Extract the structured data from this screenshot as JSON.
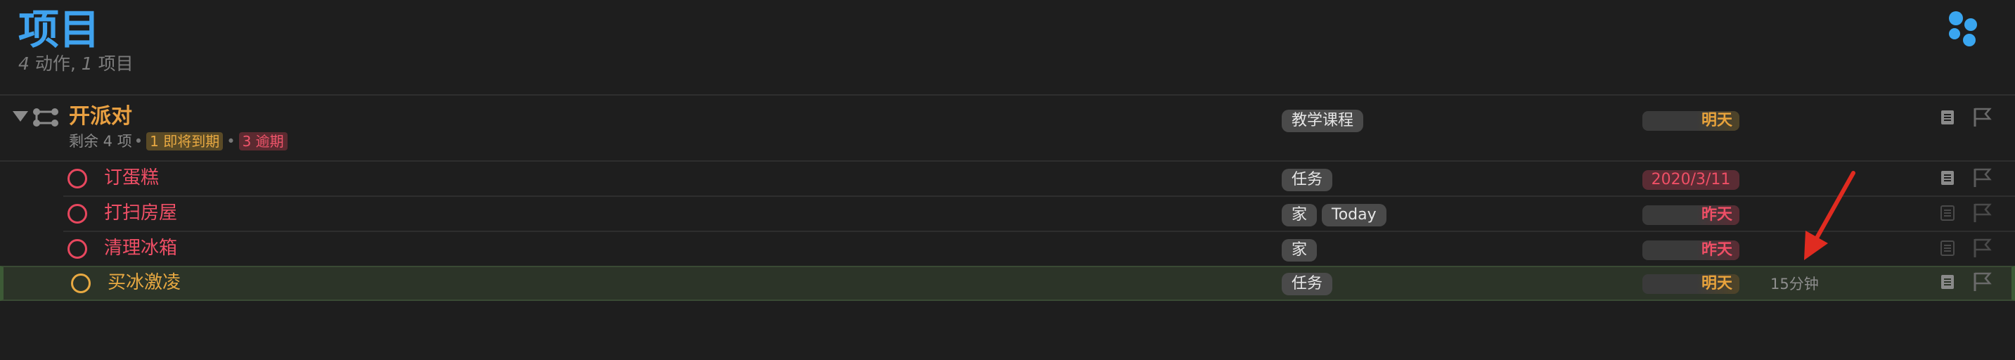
{
  "header": {
    "title": "项目",
    "subtitle_count1": "4",
    "subtitle_label1": " 动作, ",
    "subtitle_count2": "1",
    "subtitle_label2": " 项目"
  },
  "project": {
    "title": "开派对",
    "remaining": "剩余 4 项",
    "due_soon_badge": "1 即将到期",
    "overdue_badge": "3 逾期",
    "tag": "教学课程",
    "due": "明天"
  },
  "tasks": [
    {
      "title": "订蛋糕",
      "tags": [
        "任务"
      ],
      "due": "2020/3/11",
      "estimate": ""
    },
    {
      "title": "打扫房屋",
      "tags": [
        "家",
        "Today"
      ],
      "due": "昨天",
      "estimate": ""
    },
    {
      "title": "清理冰箱",
      "tags": [
        "家"
      ],
      "due": "昨天",
      "estimate": ""
    },
    {
      "title": "买冰激凌",
      "tags": [
        "任务"
      ],
      "due": "明天",
      "estimate": "15分钟"
    }
  ],
  "colors": {
    "accent": "#3fa2ee",
    "project_orange": "#e8a042",
    "overdue_red": "#ef4f66",
    "background": "#1e1e1e"
  },
  "icons": [
    "perspective-icon",
    "disclosure-triangle-icon",
    "project-icon",
    "note-icon",
    "flag-icon",
    "annotation-arrow"
  ]
}
